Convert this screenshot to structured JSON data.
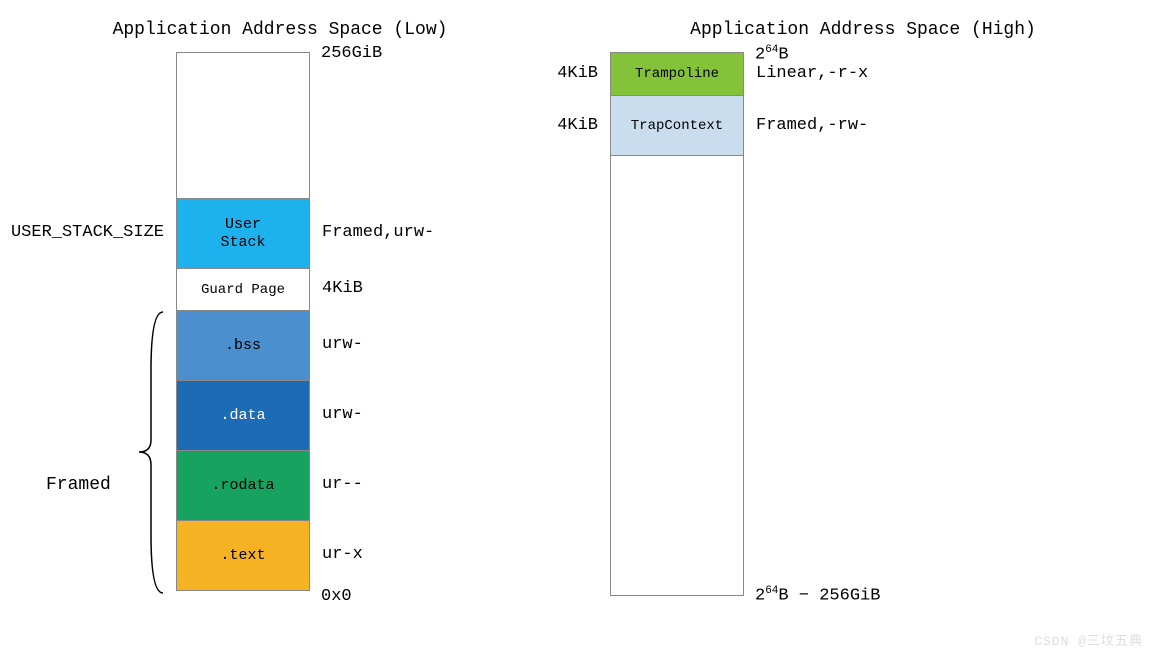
{
  "title_low": "Application Address Space (Low)",
  "title_high": "Application Address Space (High)",
  "low": {
    "top_addr": "256GiB",
    "bottom_addr": "0x0",
    "user_stack_left": "USER_STACK_SIZE",
    "user_stack_label": "User Stack",
    "user_stack_right": "Framed,urw-",
    "guard_label": "Guard Page",
    "guard_right": "4KiB",
    "bss_label": ".bss",
    "bss_right": "urw-",
    "data_label": ".data",
    "data_right": "urw-",
    "rodata_label": ".rodata",
    "rodata_right": "ur--",
    "text_label": ".text",
    "text_right": "ur-x",
    "framed_label": "Framed"
  },
  "high": {
    "trampoline_left": "4KiB",
    "trampoline_label": "Trampoline",
    "trampoline_right": "Linear,-r-x",
    "trapcontext_left": "4KiB",
    "trapcontext_label": "TrapContext",
    "trapcontext_right": "Framed,-rw-"
  },
  "watermark": "CSDN @三坟五典"
}
